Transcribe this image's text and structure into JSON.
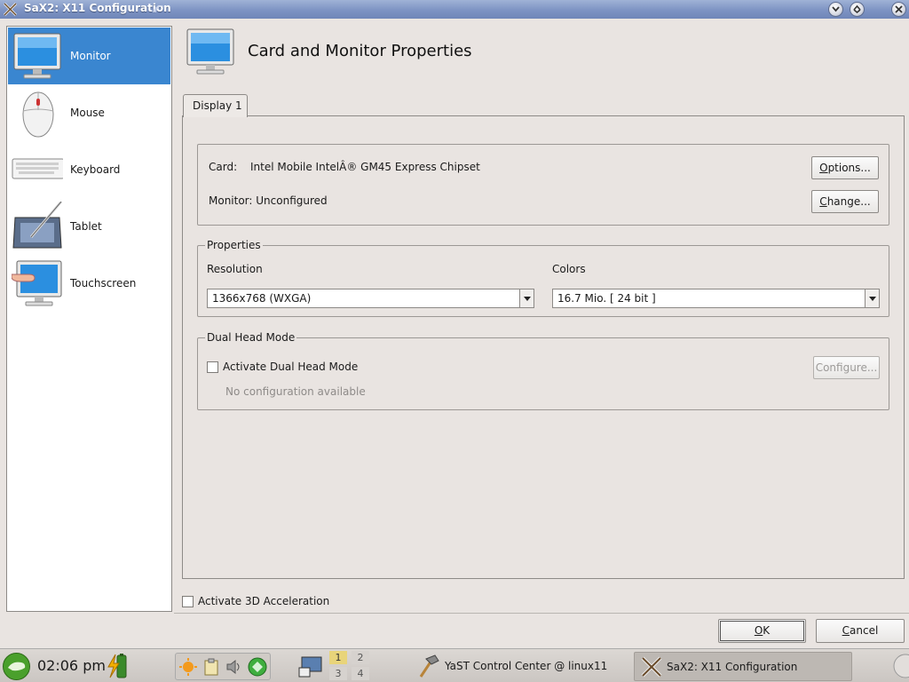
{
  "window": {
    "title": "SaX2: X11 Configuration"
  },
  "sidebar": {
    "items": [
      {
        "label": "Monitor",
        "icon": "monitor-icon",
        "selected": true
      },
      {
        "label": "Mouse",
        "icon": "mouse-icon"
      },
      {
        "label": "Keyboard",
        "icon": "keyboard-icon"
      },
      {
        "label": "Tablet",
        "icon": "tablet-icon"
      },
      {
        "label": "Touchscreen",
        "icon": "touchscreen-icon"
      }
    ]
  },
  "header": {
    "title": "Card and Monitor Properties"
  },
  "tabs": [
    {
      "label": "Display 1"
    }
  ],
  "card_section": {
    "card_label": "Card:",
    "card_value": "Intel Mobile IntelÂ® GM45 Express Chipset",
    "monitor_label": "Monitor: Unconfigured",
    "options_button": {
      "mnemonic": "O",
      "rest": "ptions..."
    },
    "change_button": {
      "mnemonic": "C",
      "rest": "hange..."
    }
  },
  "properties": {
    "title": "Properties",
    "resolution_label": "Resolution",
    "resolution_value": "1366x768 (WXGA)",
    "colors_label": "Colors",
    "colors_value": "16.7 Mio. [ 24 bit ]"
  },
  "dual_head": {
    "title": "Dual Head Mode",
    "checkbox_label": "Activate Dual Head Mode",
    "configure_button": "Configure...",
    "status": "No configuration available"
  },
  "accel_checkbox_label": "Activate 3D Acceleration",
  "dialog_buttons": {
    "ok": {
      "mnemonic": "O",
      "rest": "K"
    },
    "cancel": {
      "before": "",
      "mnemonic": "C",
      "rest": "ancel"
    }
  },
  "taskbar": {
    "clock": "02:06 pm",
    "pager": [
      "1",
      "2",
      "3",
      "4"
    ],
    "tasks": [
      {
        "label": "YaST Control Center @ linux11"
      },
      {
        "label": "SaX2: X11 Configuration",
        "active": true
      }
    ]
  },
  "colors": {
    "selection": "#3a86d0",
    "titlebar": "#7d93c3"
  }
}
